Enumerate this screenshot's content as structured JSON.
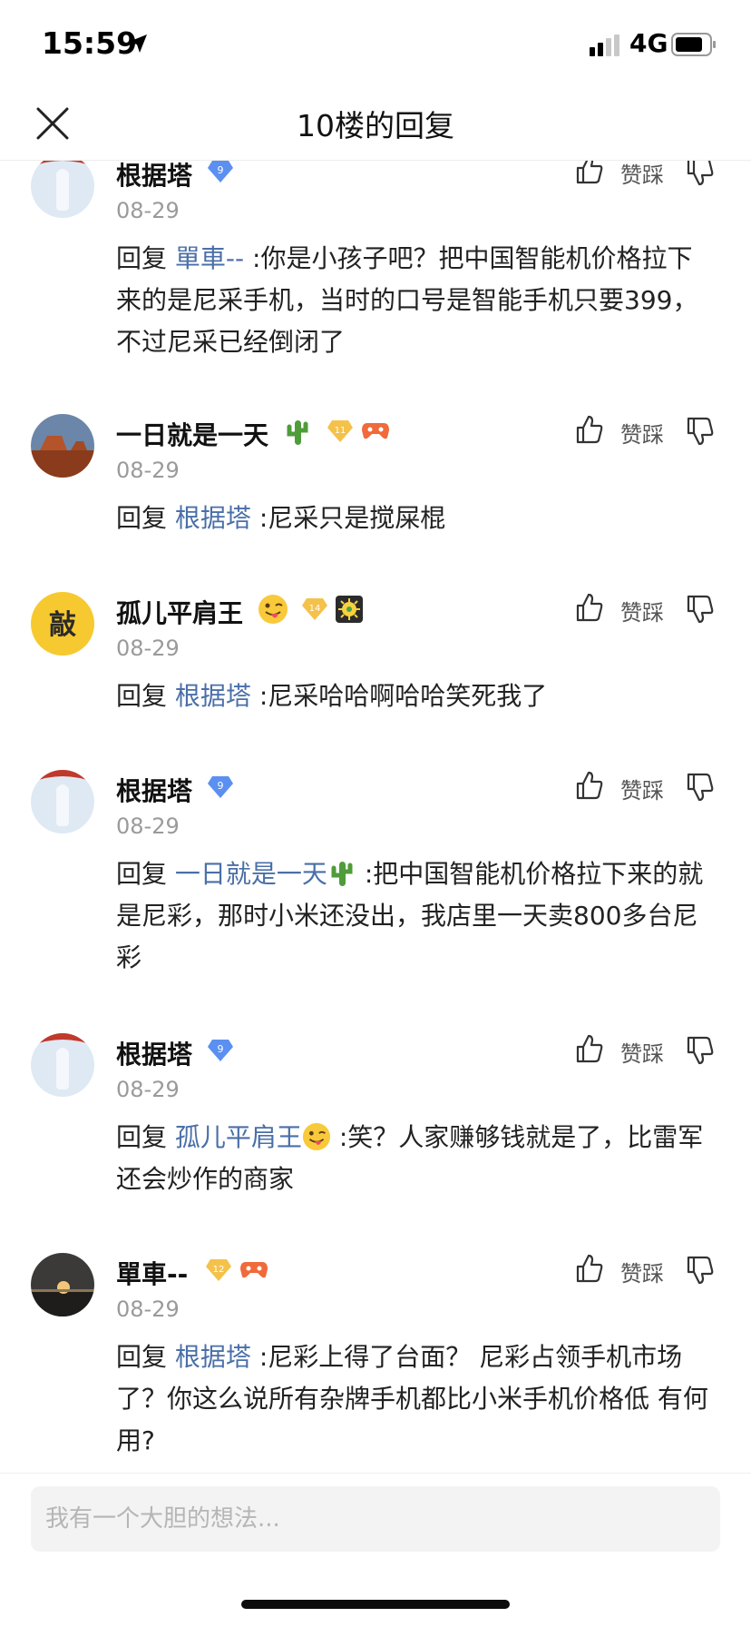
{
  "status_bar": {
    "time": "15:59",
    "network": "4G"
  },
  "header": {
    "title": "10楼的回复"
  },
  "vote_label": "赞踩",
  "reply_prefix": "回复 ",
  "replies": [
    {
      "name": "根据塔",
      "level": "9",
      "date": "08-29",
      "mention": "單車--",
      "text": " :你是小孩子吧？把中国智能机价格拉下来的是尼采手机，当时的口号是智能手机只要399，不过尼采已经倒闭了",
      "emoji": ""
    },
    {
      "name": "一日就是一天",
      "level": "11",
      "date": "08-29",
      "mention": "根据塔",
      "text": " :尼采只是搅屎棍",
      "emoji": "cactus-icon"
    },
    {
      "name": "孤儿平肩王",
      "level": "14",
      "date": "08-29",
      "mention": "根据塔",
      "text": " :尼采哈哈啊哈哈笑死我了",
      "emoji": "winking-tongue-face-icon"
    },
    {
      "name": "根据塔",
      "level": "9",
      "date": "08-29",
      "mention": "一日就是一天",
      "text": " :把中国智能机价格拉下来的就是尼彩，那时小米还没出，我店里一天卖800多台尼彩",
      "emoji": ""
    },
    {
      "name": "根据塔",
      "level": "9",
      "date": "08-29",
      "mention": "孤儿平肩王",
      "text": " :笑？人家赚够钱就是了，比雷军还会炒作的商家",
      "emoji": ""
    },
    {
      "name": "單車--",
      "level": "12",
      "date": "08-29",
      "mention": "根据塔",
      "text": " :尼彩上得了台面？ 尼彩占领手机市场了？你这么说所有杂牌手机都比小米手机价格低 有何用?",
      "emoji": ""
    }
  ],
  "input": {
    "placeholder": "我有一个大胆的想法..."
  },
  "colors": {
    "mention": "#4a6fa8",
    "date": "#9a9a9a",
    "badge_blue": "#5b8ff0",
    "badge_gold": "#f4c24a"
  }
}
